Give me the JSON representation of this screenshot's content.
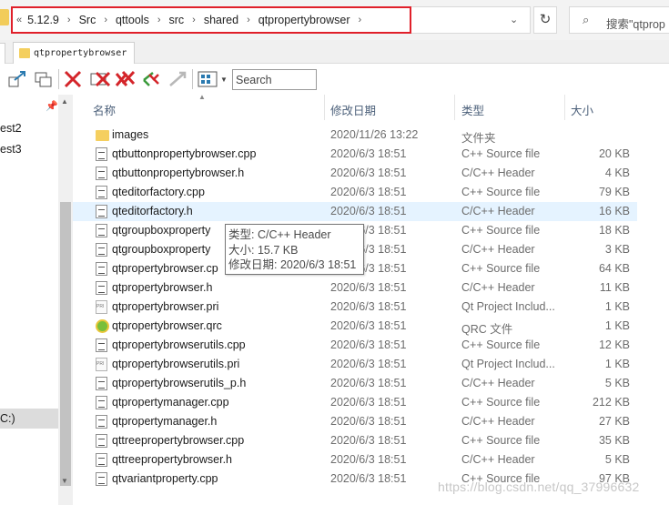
{
  "address": {
    "lead": "«",
    "crumbs": [
      "5.12.9",
      "Src",
      "qttools",
      "src",
      "shared",
      "qtpropertybrowser"
    ],
    "dropdown": "⌄",
    "refresh": "↻"
  },
  "search_bar": {
    "placeholder": "搜索\"qtprop"
  },
  "tab": {
    "label": "qtpropertybrowser"
  },
  "toolbar": {
    "search_placeholder": "Search"
  },
  "nav": {
    "items": [
      "est2",
      "est3"
    ],
    "selected_label": "C:)"
  },
  "columns": {
    "name": "名称",
    "date": "修改日期",
    "type": "类型",
    "size": "大小"
  },
  "files": [
    {
      "name": "images",
      "date": "2020/11/26 13:22",
      "type": "文件夹",
      "size": "",
      "icon": "folder-icon"
    },
    {
      "name": "qtbuttonpropertybrowser.cpp",
      "date": "2020/6/3 18:51",
      "type": "C++ Source file",
      "size": "20 KB",
      "icon": "cpp-file-icon"
    },
    {
      "name": "qtbuttonpropertybrowser.h",
      "date": "2020/6/3 18:51",
      "type": "C/C++ Header",
      "size": "4 KB",
      "icon": "header-file-icon"
    },
    {
      "name": "qteditorfactory.cpp",
      "date": "2020/6/3 18:51",
      "type": "C++ Source file",
      "size": "79 KB",
      "icon": "cpp-file-icon"
    },
    {
      "name": "qteditorfactory.h",
      "date": "2020/6/3 18:51",
      "type": "C/C++ Header",
      "size": "16 KB",
      "icon": "header-file-icon"
    },
    {
      "name": "qtgroupboxproperty",
      "date": "2020/6/3 18:51",
      "type": "C++ Source file",
      "size": "18 KB",
      "icon": "cpp-file-icon"
    },
    {
      "name": "qtgroupboxproperty",
      "date": "2020/6/3 18:51",
      "type": "C/C++ Header",
      "size": "3 KB",
      "icon": "header-file-icon"
    },
    {
      "name": "qtpropertybrowser.cp",
      "date": "2020/6/3 18:51",
      "type": "C++ Source file",
      "size": "64 KB",
      "icon": "cpp-file-icon"
    },
    {
      "name": "qtpropertybrowser.h",
      "date": "2020/6/3 18:51",
      "type": "C/C++ Header",
      "size": "11 KB",
      "icon": "header-file-icon"
    },
    {
      "name": "qtpropertybrowser.pri",
      "date": "2020/6/3 18:51",
      "type": "Qt Project Includ...",
      "size": "1 KB",
      "icon": "pri-file-icon"
    },
    {
      "name": "qtpropertybrowser.qrc",
      "date": "2020/6/3 18:51",
      "type": "QRC 文件",
      "size": "1 KB",
      "icon": "qrc-file-icon"
    },
    {
      "name": "qtpropertybrowserutils.cpp",
      "date": "2020/6/3 18:51",
      "type": "C++ Source file",
      "size": "12 KB",
      "icon": "cpp-file-icon"
    },
    {
      "name": "qtpropertybrowserutils.pri",
      "date": "2020/6/3 18:51",
      "type": "Qt Project Includ...",
      "size": "1 KB",
      "icon": "pri-file-icon"
    },
    {
      "name": "qtpropertybrowserutils_p.h",
      "date": "2020/6/3 18:51",
      "type": "C/C++ Header",
      "size": "5 KB",
      "icon": "header-file-icon"
    },
    {
      "name": "qtpropertymanager.cpp",
      "date": "2020/6/3 18:51",
      "type": "C++ Source file",
      "size": "212 KB",
      "icon": "cpp-file-icon"
    },
    {
      "name": "qtpropertymanager.h",
      "date": "2020/6/3 18:51",
      "type": "C/C++ Header",
      "size": "27 KB",
      "icon": "header-file-icon"
    },
    {
      "name": "qttreepropertybrowser.cpp",
      "date": "2020/6/3 18:51",
      "type": "C++ Source file",
      "size": "35 KB",
      "icon": "cpp-file-icon"
    },
    {
      "name": "qttreepropertybrowser.h",
      "date": "2020/6/3 18:51",
      "type": "C/C++ Header",
      "size": "5 KB",
      "icon": "header-file-icon"
    },
    {
      "name": "qtvariantproperty.cpp",
      "date": "2020/6/3 18:51",
      "type": "C++ Source file",
      "size": "97 KB",
      "icon": "cpp-file-icon"
    }
  ],
  "tooltip": {
    "type_line": "类型: C/C++ Header",
    "size_line": "大小: 15.7 KB",
    "date_line": "修改日期: 2020/6/3 18:51"
  },
  "watermark": "https://blog.csdn.net/qq_37996632"
}
